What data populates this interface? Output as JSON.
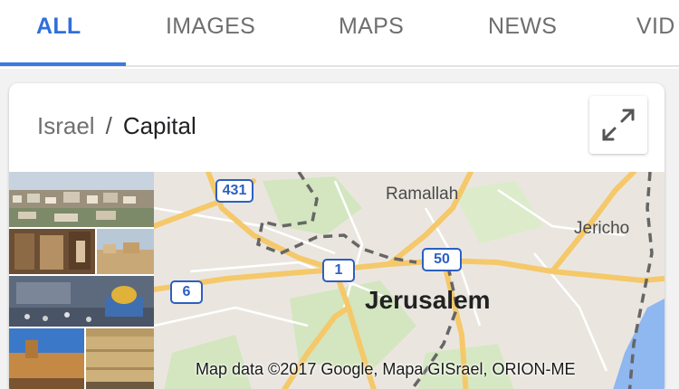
{
  "tabs": [
    {
      "label": "ALL",
      "active": true
    },
    {
      "label": "IMAGES",
      "active": false
    },
    {
      "label": "MAPS",
      "active": false
    },
    {
      "label": "NEWS",
      "active": false
    },
    {
      "label": "VID",
      "active": false
    }
  ],
  "breadcrumb": {
    "parent": "Israel",
    "separator": "/",
    "current": "Capital"
  },
  "map": {
    "labels": {
      "ramallah": "Ramallah",
      "jericho": "Jericho",
      "jerusalem": "Jerusalem"
    },
    "shields": [
      "431",
      "1",
      "50",
      "6"
    ],
    "attribution": "Map data ©2017 Google, Mapa GISrael, ORION-ME",
    "expand_icon": "expand-arrows-icon"
  },
  "colors": {
    "accent": "#2f6fdc",
    "road": "#f5c86a",
    "water": "#8ab4f8",
    "park": "#cfe3b8"
  }
}
